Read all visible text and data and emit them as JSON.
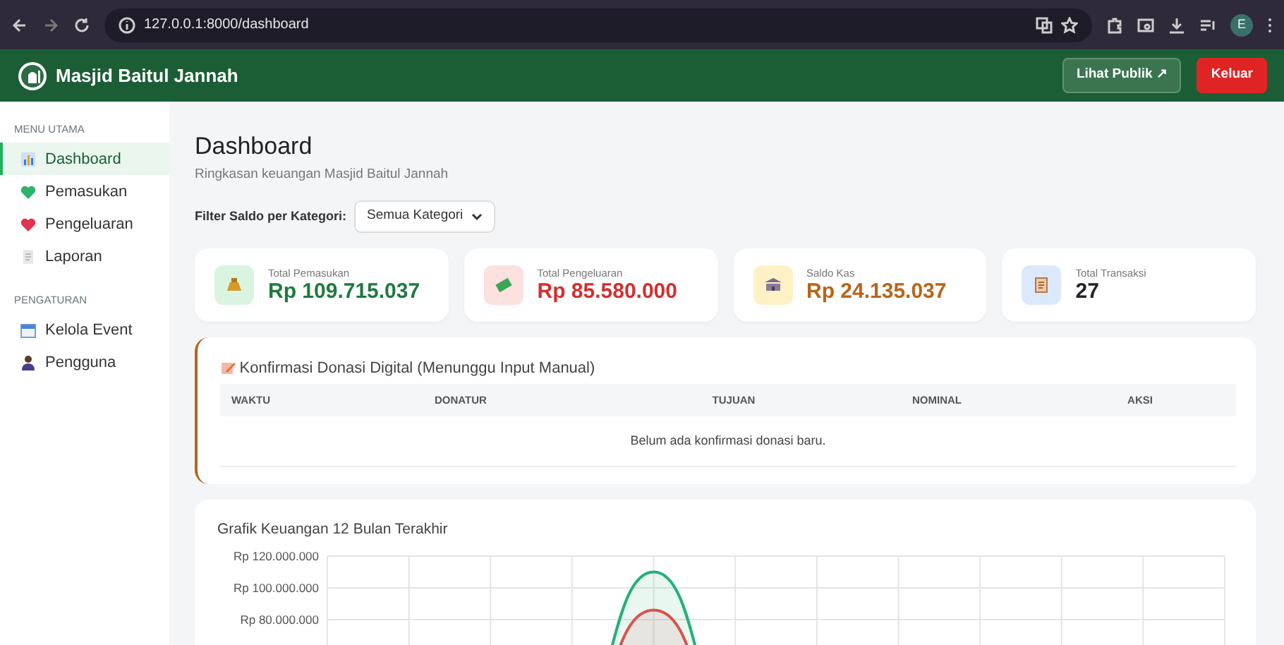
{
  "browser": {
    "url": "127.0.0.1:8000/dashboard",
    "profile_initial": "E"
  },
  "navbar": {
    "brand": "Masjid Baitul Jannah",
    "buttons": [
      {
        "label": "Lihat Publik ↗",
        "kind": "outline"
      },
      {
        "label": "Keluar",
        "kind": "danger"
      }
    ]
  },
  "sidebar": {
    "sections": [
      {
        "title": "MENU UTAMA",
        "items": [
          {
            "label": "Dashboard",
            "selected": true
          },
          {
            "label": "Pemasukan",
            "selected": false
          },
          {
            "label": "Pengeluaran",
            "selected": false
          },
          {
            "label": "Laporan",
            "selected": false
          }
        ]
      },
      {
        "title": "PENGATURAN",
        "items": [
          {
            "label": "Kelola Event",
            "selected": false
          },
          {
            "label": "Pengguna",
            "selected": false
          }
        ]
      }
    ]
  },
  "page": {
    "title": "Dashboard",
    "subtitle": "Ringkasan keuangan Masjid Baitul Jannah",
    "filter": {
      "label": "Filter Saldo per Kategori:",
      "value": "Semua Kategori"
    }
  },
  "stats": [
    {
      "label": "Total Pemasukan",
      "value": "Rp 109.715.037",
      "color": "#1e7a3f"
    },
    {
      "label": "Total Pengeluaran",
      "value": "Rp 85.580.000",
      "color": "#d32f2f"
    },
    {
      "label": "Saldo Kas",
      "value": "Rp 24.135.037",
      "color": "#b8651b"
    },
    {
      "label": "Total Transaksi",
      "value": "27",
      "color": "#212529"
    }
  ],
  "donations": {
    "title": "Konfirmasi Donasi Digital (Menunggu Input Manual)",
    "columns": [
      "WAKTU",
      "DONATUR",
      "TUJUAN",
      "NOMINAL",
      "AKSI"
    ],
    "empty_message": "Belum ada konfirmasi donasi baru."
  },
  "chart": {
    "title": "Grafik Keuangan 12 Bulan Terakhir",
    "y_axis_labels": [
      "Rp 120.000.000",
      "Rp 100.000.000",
      "Rp 80.000.000"
    ]
  }
}
